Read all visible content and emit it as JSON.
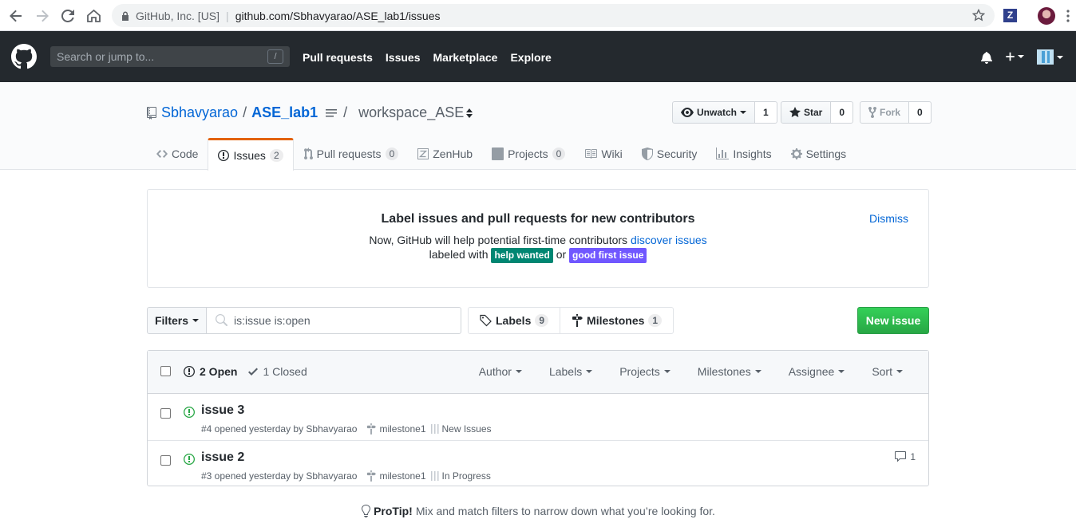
{
  "browser": {
    "security_org": "GitHub, Inc. [US]",
    "url": "github.com/Sbhavyarao/ASE_lab1/issues",
    "extension_letter": "Z"
  },
  "header": {
    "search_placeholder": "Search or jump to...",
    "search_shortcut": "/",
    "nav": [
      "Pull requests",
      "Issues",
      "Marketplace",
      "Explore"
    ]
  },
  "repo": {
    "owner": "Sbhavyarao",
    "name": "ASE_lab1",
    "workspace": "workspace_ASE",
    "unwatch_label": "Unwatch",
    "unwatch_count": "1",
    "star_label": "Star",
    "star_count": "0",
    "fork_label": "Fork",
    "fork_count": "0",
    "tabs": {
      "code": "Code",
      "issues": "Issues",
      "issues_count": "2",
      "pulls": "Pull requests",
      "pulls_count": "0",
      "zenhub": "ZenHub",
      "projects": "Projects",
      "projects_count": "0",
      "wiki": "Wiki",
      "security": "Security",
      "insights": "Insights",
      "settings": "Settings"
    }
  },
  "onboarding": {
    "title": "Label issues and pull requests for new contributors",
    "line1_prefix": "Now, GitHub will help potential first-time contributors",
    "line1_link": "discover issues",
    "line2_prefix": "labeled with",
    "label_help": "help wanted",
    "label_help_color": "#008672",
    "or_text": "or",
    "label_good": "good first issue",
    "label_good_color": "#7057ff",
    "dismiss": "Dismiss"
  },
  "subnav": {
    "filters": "Filters",
    "search_value": "is:issue is:open",
    "labels": "Labels",
    "labels_count": "9",
    "milestones": "Milestones",
    "milestones_count": "1",
    "new_issue": "New issue"
  },
  "issues_header": {
    "open": "2 Open",
    "closed": "1 Closed",
    "menus": [
      "Author",
      "Labels",
      "Projects",
      "Milestones",
      "Assignee",
      "Sort"
    ]
  },
  "issues": [
    {
      "title": "issue 3",
      "meta": "#4 opened yesterday by Sbhavyarao",
      "milestone": "milestone1",
      "project": "New Issues",
      "comments": ""
    },
    {
      "title": "issue 2",
      "meta": "#3 opened yesterday by Sbhavyarao",
      "milestone": "milestone1",
      "project": "In Progress",
      "comments": "1"
    }
  ],
  "protip": {
    "bold": "ProTip!",
    "text": "Mix and match filters to narrow down what you’re looking for."
  },
  "colors": {
    "header_bg": "#24292e",
    "link": "#0366d6",
    "open_issue": "#28a745",
    "selected_tab_accent": "#e36209",
    "new_issue_button": "#28a745"
  }
}
